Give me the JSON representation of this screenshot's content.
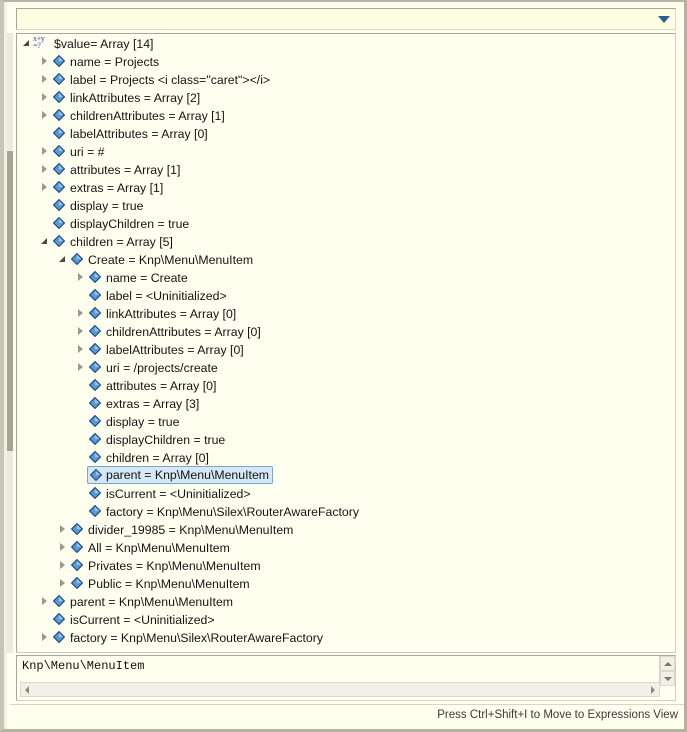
{
  "window": {
    "background_color": "#fffff0",
    "frame_color": "#c9c5b4"
  },
  "toolbar": {
    "menu_icon": "chevron-down-icon"
  },
  "tree": {
    "root_icon": "expression-variable-icon",
    "expanded_icon": "triangle-down-icon",
    "collapsed_icon": "triangle-right-icon",
    "node_icon": "blue-diamond-icon",
    "rows": [
      {
        "indent": 0,
        "twisty": "expanded",
        "icon": "expr",
        "text": "$value= Array [14]",
        "selected": false
      },
      {
        "indent": 1,
        "twisty": "collapsed",
        "icon": "diamond",
        "text": "name = Projects",
        "selected": false
      },
      {
        "indent": 1,
        "twisty": "collapsed",
        "icon": "diamond",
        "text": "label = Projects <i class=\"caret\"></i>",
        "selected": false
      },
      {
        "indent": 1,
        "twisty": "collapsed",
        "icon": "diamond",
        "text": "linkAttributes = Array [2]",
        "selected": false
      },
      {
        "indent": 1,
        "twisty": "collapsed",
        "icon": "diamond",
        "text": "childrenAttributes = Array [1]",
        "selected": false
      },
      {
        "indent": 1,
        "twisty": "none",
        "icon": "diamond",
        "text": "labelAttributes = Array [0]",
        "selected": false
      },
      {
        "indent": 1,
        "twisty": "collapsed",
        "icon": "diamond",
        "text": "uri = #",
        "selected": false
      },
      {
        "indent": 1,
        "twisty": "collapsed",
        "icon": "diamond",
        "text": "attributes = Array [1]",
        "selected": false
      },
      {
        "indent": 1,
        "twisty": "collapsed",
        "icon": "diamond",
        "text": "extras = Array [1]",
        "selected": false
      },
      {
        "indent": 1,
        "twisty": "none",
        "icon": "diamond",
        "text": "display = true",
        "selected": false
      },
      {
        "indent": 1,
        "twisty": "none",
        "icon": "diamond",
        "text": "displayChildren = true",
        "selected": false
      },
      {
        "indent": 1,
        "twisty": "expanded",
        "icon": "diamond",
        "text": "children = Array [5]",
        "selected": false
      },
      {
        "indent": 2,
        "twisty": "expanded",
        "icon": "diamond",
        "text": "Create = Knp\\Menu\\MenuItem",
        "selected": false
      },
      {
        "indent": 3,
        "twisty": "collapsed",
        "icon": "diamond",
        "text": "name = Create",
        "selected": false
      },
      {
        "indent": 3,
        "twisty": "none",
        "icon": "diamond",
        "text": "label = <Uninitialized>",
        "selected": false
      },
      {
        "indent": 3,
        "twisty": "collapsed",
        "icon": "diamond",
        "text": "linkAttributes = Array [0]",
        "selected": false
      },
      {
        "indent": 3,
        "twisty": "collapsed",
        "icon": "diamond",
        "text": "childrenAttributes = Array [0]",
        "selected": false
      },
      {
        "indent": 3,
        "twisty": "collapsed",
        "icon": "diamond",
        "text": "labelAttributes = Array [0]",
        "selected": false
      },
      {
        "indent": 3,
        "twisty": "collapsed",
        "icon": "diamond",
        "text": "uri = /projects/create",
        "selected": false
      },
      {
        "indent": 3,
        "twisty": "none",
        "icon": "diamond",
        "text": "attributes = Array [0]",
        "selected": false
      },
      {
        "indent": 3,
        "twisty": "none",
        "icon": "diamond",
        "text": "extras = Array [3]",
        "selected": false
      },
      {
        "indent": 3,
        "twisty": "none",
        "icon": "diamond",
        "text": "display = true",
        "selected": false
      },
      {
        "indent": 3,
        "twisty": "none",
        "icon": "diamond",
        "text": "displayChildren = true",
        "selected": false
      },
      {
        "indent": 3,
        "twisty": "none",
        "icon": "diamond",
        "text": "children = Array [0]",
        "selected": false
      },
      {
        "indent": 3,
        "twisty": "none",
        "icon": "diamond",
        "text": "parent = Knp\\Menu\\MenuItem",
        "selected": true
      },
      {
        "indent": 3,
        "twisty": "none",
        "icon": "diamond",
        "text": "isCurrent = <Uninitialized>",
        "selected": false
      },
      {
        "indent": 3,
        "twisty": "none",
        "icon": "diamond",
        "text": "factory = Knp\\Menu\\Silex\\RouterAwareFactory",
        "selected": false
      },
      {
        "indent": 2,
        "twisty": "collapsed",
        "icon": "diamond",
        "text": "divider_19985 = Knp\\Menu\\MenuItem",
        "selected": false
      },
      {
        "indent": 2,
        "twisty": "collapsed",
        "icon": "diamond",
        "text": "All = Knp\\Menu\\MenuItem",
        "selected": false
      },
      {
        "indent": 2,
        "twisty": "collapsed",
        "icon": "diamond",
        "text": "Privates = Knp\\Menu\\MenuItem",
        "selected": false
      },
      {
        "indent": 2,
        "twisty": "collapsed",
        "icon": "diamond",
        "text": "Public = Knp\\Menu\\MenuItem",
        "selected": false
      },
      {
        "indent": 1,
        "twisty": "collapsed",
        "icon": "diamond",
        "text": "parent = Knp\\Menu\\MenuItem",
        "selected": false
      },
      {
        "indent": 1,
        "twisty": "none",
        "icon": "diamond",
        "text": "isCurrent = <Uninitialized>",
        "selected": false
      },
      {
        "indent": 1,
        "twisty": "collapsed",
        "icon": "diamond",
        "text": "factory = Knp\\Menu\\Silex\\RouterAwareFactory",
        "selected": false
      }
    ],
    "selection_bg_color": "#d6e7f6",
    "selection_border_color": "#7aa7cc"
  },
  "detail_pane": {
    "value": "Knp\\Menu\\MenuItem",
    "scroll_up_icon": "arrow-up-icon",
    "scroll_down_icon": "arrow-down-icon",
    "scroll_left_icon": "arrow-left-icon",
    "scroll_right_icon": "arrow-right-icon"
  },
  "status_bar": {
    "message": "Press Ctrl+Shift+I to Move to Expressions View"
  }
}
